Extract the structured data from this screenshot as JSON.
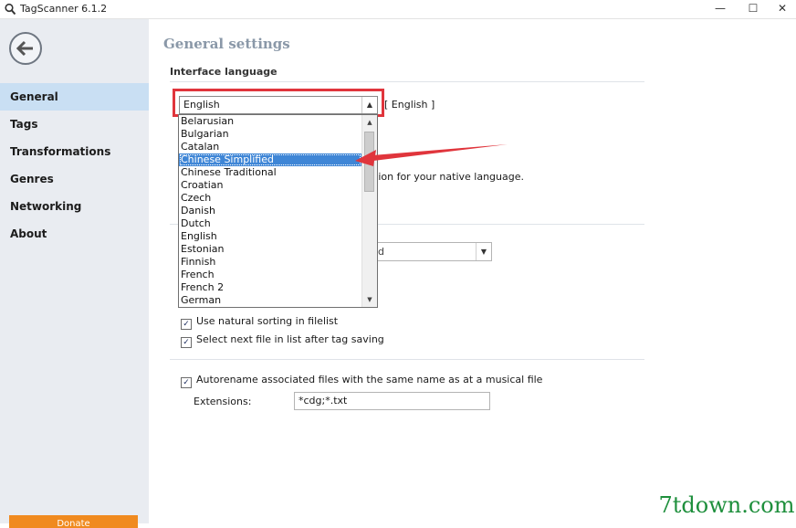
{
  "window": {
    "title": "TagScanner 6.1.2",
    "controls": {
      "minimize": "—",
      "maximize": "☐",
      "close": "✕"
    }
  },
  "sidebar": {
    "items": [
      {
        "label": "General",
        "active": true
      },
      {
        "label": "Tags"
      },
      {
        "label": "Transformations"
      },
      {
        "label": "Genres"
      },
      {
        "label": "Networking"
      },
      {
        "label": "About"
      }
    ],
    "donate_label": "Donate"
  },
  "main": {
    "page_title": "General settings",
    "interface_language": {
      "section_label": "Interface language",
      "selected": "English",
      "bracket_text": "[ English ]",
      "native_text_fragment": "tion for your native language.",
      "options": [
        "Belarusian",
        "Bulgarian",
        "Catalan",
        "Chinese Simplified",
        "Chinese Traditional",
        "Croatian",
        "Czech",
        "Danish",
        "Dutch",
        "English",
        "Estonian",
        "Finnish",
        "French",
        "French 2",
        "German"
      ],
      "highlighted": "Chinese Simplified"
    },
    "combo2_value_fragment": "d",
    "checkboxes": [
      {
        "label": "Use natural sorting in filelist",
        "checked": true
      },
      {
        "label": "Select next file in list after tag saving",
        "checked": true
      },
      {
        "label": "Autorename associated files with the same name as at a musical file",
        "checked": true
      }
    ],
    "extensions": {
      "label": "Extensions:",
      "value": "*cdg;*.txt"
    }
  },
  "watermark": "7tdown.com",
  "colors": {
    "sidebar_bg": "#e9ecf1",
    "nav_active": "#c9dff3",
    "title_accent": "#8a98a8",
    "highlight": "#3f86d6",
    "annotation_red": "#e0353c",
    "donate": "#f08a1f",
    "watermark": "#1e8f3c"
  }
}
